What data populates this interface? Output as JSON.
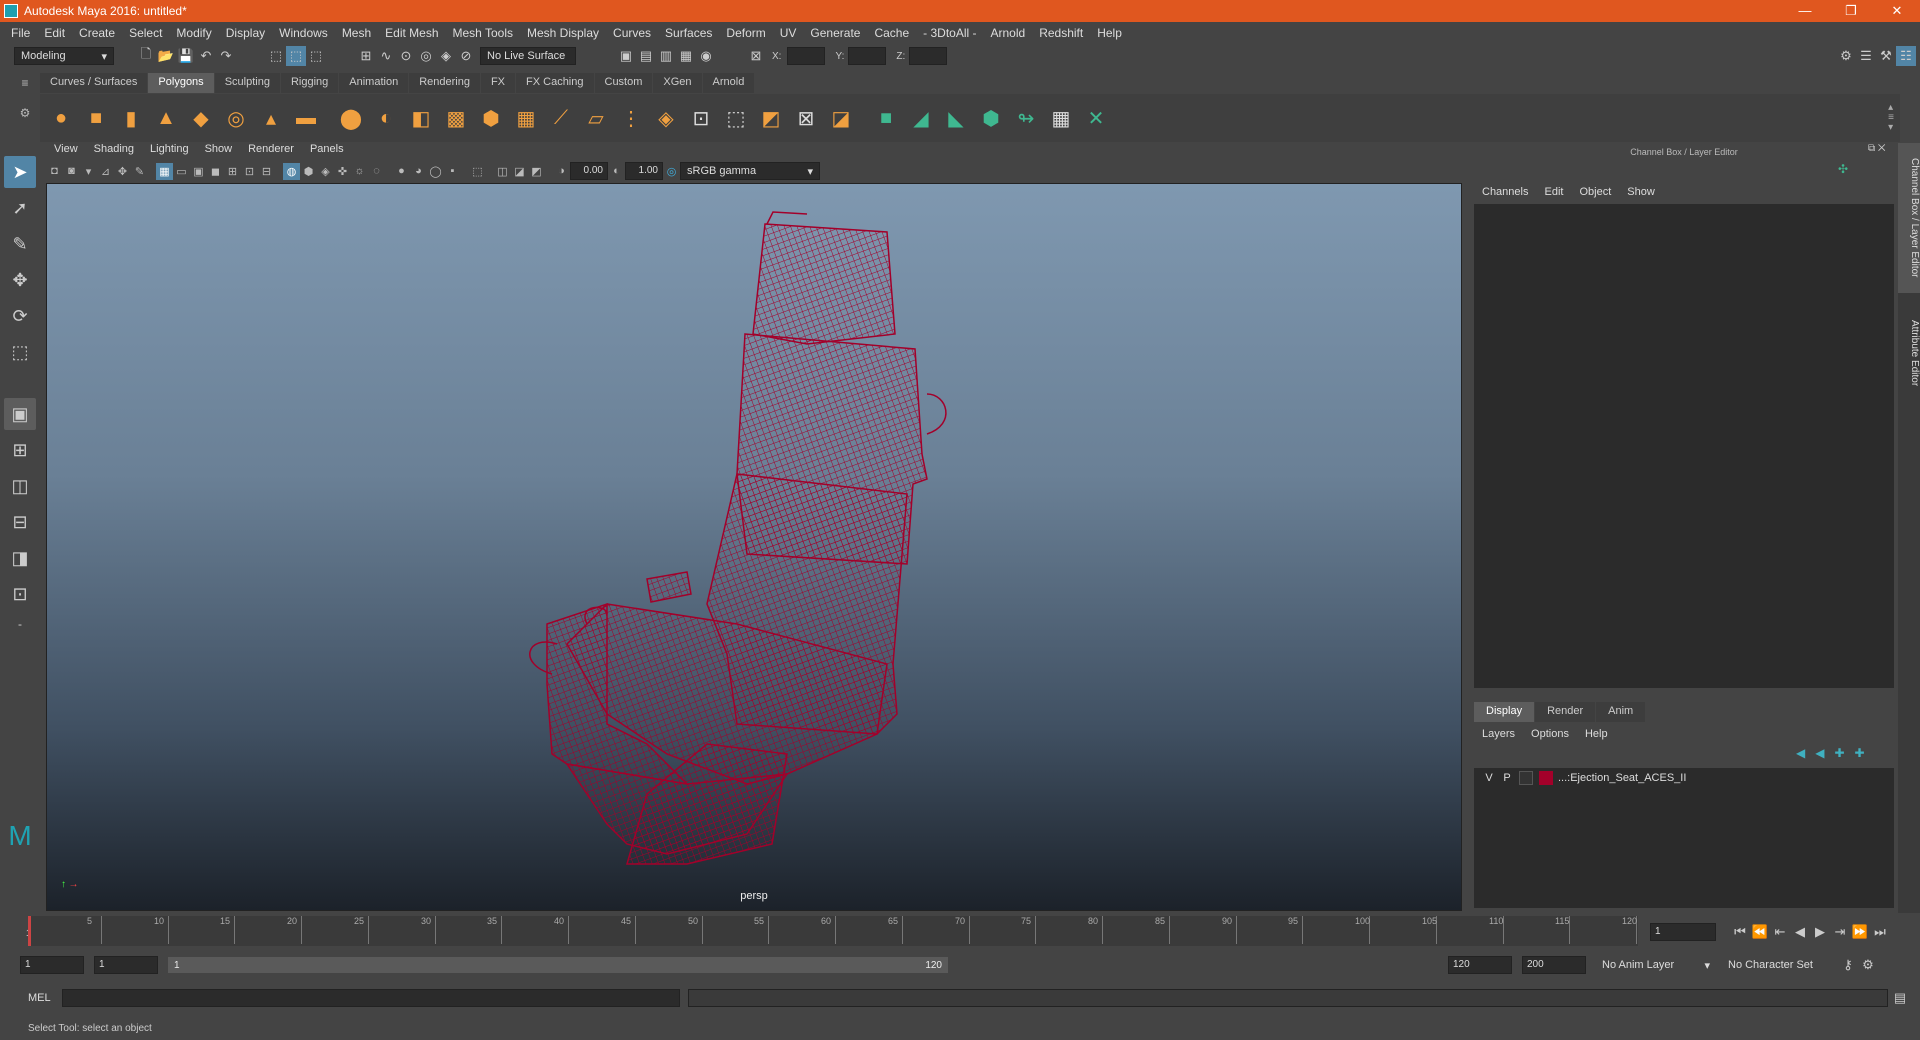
{
  "titlebar": {
    "title": "Autodesk Maya 2016: untitled*",
    "minimize": "—",
    "maximize": "❐",
    "close": "✕"
  },
  "menubar": [
    "File",
    "Edit",
    "Create",
    "Select",
    "Modify",
    "Display",
    "Windows",
    "Mesh",
    "Edit Mesh",
    "Mesh Tools",
    "Mesh Display",
    "Curves",
    "Surfaces",
    "Deform",
    "UV",
    "Generate",
    "Cache",
    "- 3DtoAll -",
    "Arnold",
    "Redshift",
    "Help"
  ],
  "statusline": {
    "menuset": "Modeling",
    "live_surface": "No Live Surface",
    "x_label": "X:",
    "y_label": "Y:",
    "z_label": "Z:"
  },
  "shelf_tabs": [
    "Curves / Surfaces",
    "Polygons",
    "Sculpting",
    "Rigging",
    "Animation",
    "Rendering",
    "FX",
    "FX Caching",
    "Custom",
    "XGen",
    "Arnold"
  ],
  "shelf_active": "Polygons",
  "viewport": {
    "menu": [
      "View",
      "Shading",
      "Lighting",
      "Show",
      "Renderer",
      "Panels"
    ],
    "exposure": "0.00",
    "gamma": "1.00",
    "colorspace": "sRGB gamma",
    "camera_label": "persp",
    "wire_color": "#a3002a"
  },
  "channelbox": {
    "header": "Channel Box / Layer Editor",
    "menu": [
      "Channels",
      "Edit",
      "Object",
      "Show"
    ]
  },
  "layer_editor": {
    "tabs": [
      "Display",
      "Render",
      "Anim"
    ],
    "active_tab": "Display",
    "menu": [
      "Layers",
      "Options",
      "Help"
    ],
    "layers": [
      {
        "v": "V",
        "p": "P",
        "name": "...:Ejection_Seat_ACES_II",
        "color": "#a3002a"
      }
    ]
  },
  "side_tabs": [
    "Channel Box / Layer Editor",
    "Attribute Editor"
  ],
  "timeline": {
    "ticks": [
      "5",
      "10",
      "15",
      "20",
      "25",
      "30",
      "35",
      "40",
      "45",
      "50",
      "55",
      "60",
      "65",
      "70",
      "75",
      "80",
      "85",
      "90",
      "95",
      "100",
      "105",
      "110",
      "115",
      "120"
    ],
    "start_label": "1",
    "current_frame": "1"
  },
  "range": {
    "start": "1",
    "inner_start": "1",
    "slider_start": "1",
    "slider_end": "120",
    "end": "120",
    "outer_end": "200",
    "anim_layer": "No Anim Layer",
    "char_set": "No Character Set"
  },
  "mel": {
    "label": "MEL"
  },
  "helpline": "Select Tool: select an object"
}
